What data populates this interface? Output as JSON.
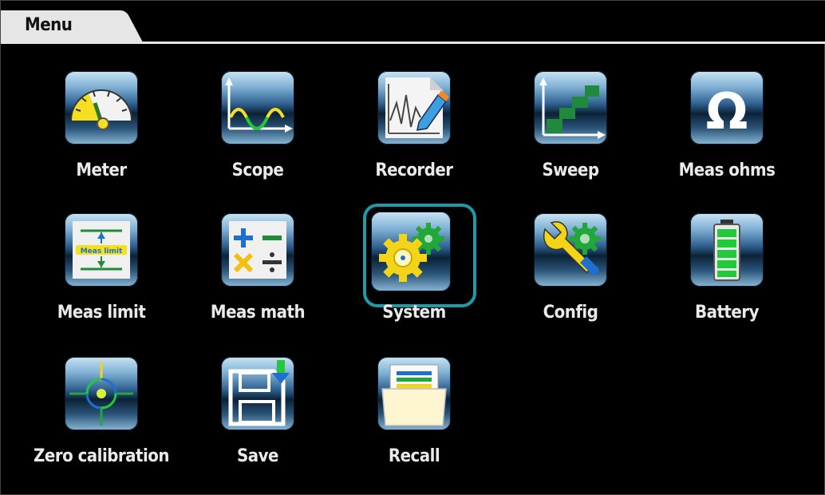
{
  "header": {
    "title": "Menu"
  },
  "items": [
    {
      "label": "Meter",
      "icon": "gauge-icon"
    },
    {
      "label": "Scope",
      "icon": "waveform-icon"
    },
    {
      "label": "Recorder",
      "icon": "recorder-pen-icon"
    },
    {
      "label": "Sweep",
      "icon": "staircase-icon"
    },
    {
      "label": "Meas ohms",
      "icon": "omega-icon"
    },
    {
      "label": "Meas limit",
      "icon": "limit-icon",
      "icon_text": "Meas limit"
    },
    {
      "label": "Meas math",
      "icon": "math-operators-icon"
    },
    {
      "label": "System",
      "icon": "gears-icon",
      "selected": true
    },
    {
      "label": "Config",
      "icon": "wrench-gear-icon"
    },
    {
      "label": "Battery",
      "icon": "battery-icon"
    },
    {
      "label": "Zero calibration",
      "icon": "crosshair-icon"
    },
    {
      "label": "Save",
      "icon": "floppy-save-icon"
    },
    {
      "label": "Recall",
      "icon": "folder-recall-icon"
    }
  ],
  "colors": {
    "selection": "#1f9aa8",
    "background": "#000000",
    "label": "#eaeaea"
  }
}
